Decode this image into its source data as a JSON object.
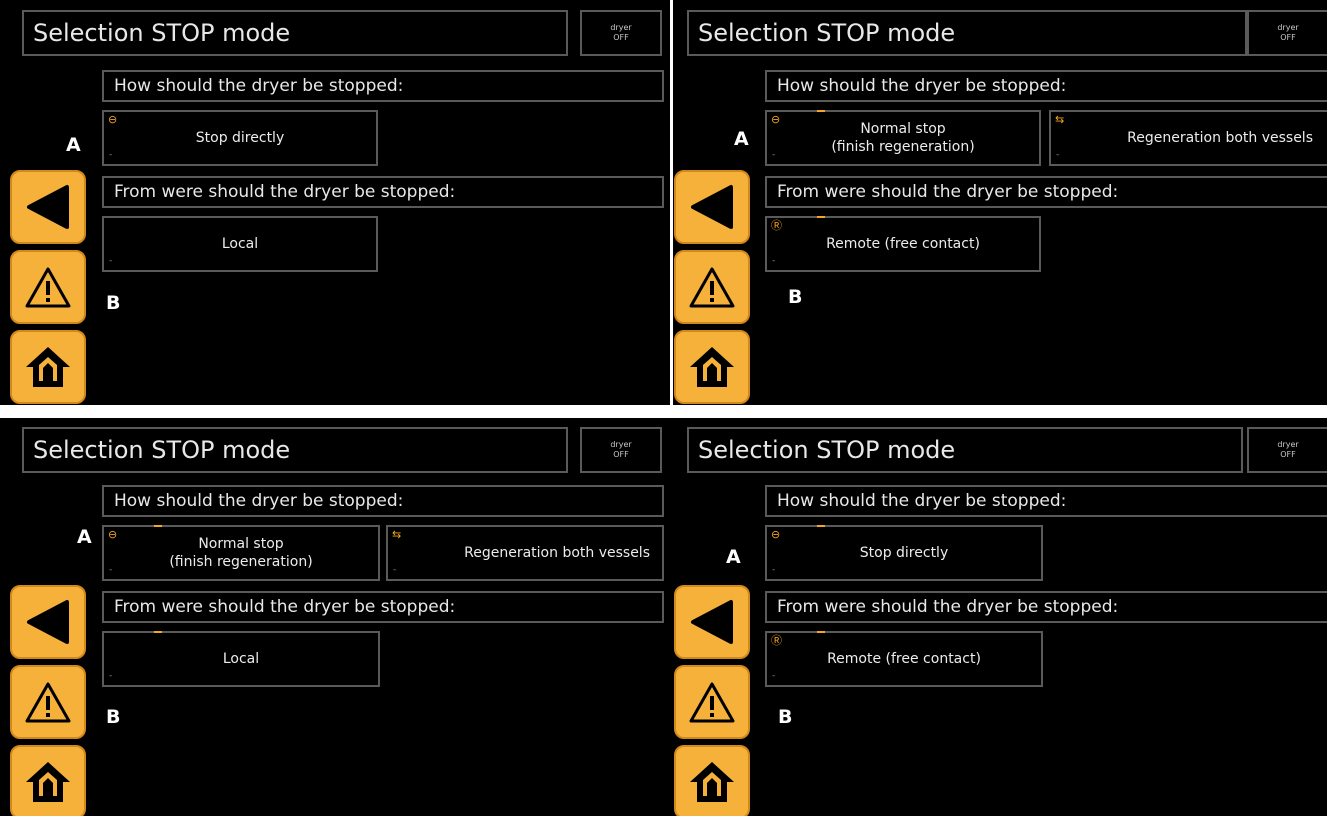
{
  "panels": [
    {
      "title": "Selection STOP mode",
      "status": {
        "line1": "dryer",
        "line2": "OFF"
      },
      "how_label": "How should the dryer be stopped:",
      "from_label": "From were should the dryer be stopped:",
      "how_options": [
        {
          "label": "Stop directly",
          "icon": "stop-circle-icon",
          "marker": "-"
        }
      ],
      "from_options": [
        {
          "label": "Local",
          "icon": "",
          "marker": "-"
        }
      ],
      "letters": {
        "a": "A",
        "b": "B"
      }
    },
    {
      "title": "Selection STOP mode",
      "status": {
        "line1": "dryer",
        "line2": "OFF"
      },
      "how_label": "How should the dryer be stopped:",
      "from_label": "From were should the dryer be stopped:",
      "how_options": [
        {
          "label": "Normal stop\n(finish regeneration)",
          "icon": "stop-circle-icon",
          "marker": "-"
        },
        {
          "label": "Regeneration both vessels",
          "icon": "regeneration-icon",
          "marker": "-"
        }
      ],
      "from_options": [
        {
          "label": "Remote (free contact)",
          "icon": "remote-icon",
          "marker": "-"
        }
      ],
      "letters": {
        "a": "A",
        "b": "B"
      }
    },
    {
      "title": "Selection STOP mode",
      "status": {
        "line1": "dryer",
        "line2": "OFF"
      },
      "how_label": "How should the dryer be stopped:",
      "from_label": "From were should the dryer be stopped:",
      "how_options": [
        {
          "label": "Normal stop\n(finish regeneration)",
          "icon": "stop-circle-icon",
          "marker": "-"
        },
        {
          "label": "Regeneration both vessels",
          "icon": "regeneration-icon",
          "marker": "-"
        }
      ],
      "from_options": [
        {
          "label": "Local",
          "icon": "",
          "marker": "-"
        }
      ],
      "letters": {
        "a": "A",
        "b": "B"
      }
    },
    {
      "title": "Selection STOP mode",
      "status": {
        "line1": "dryer",
        "line2": "OFF"
      },
      "how_label": "How should the dryer be stopped:",
      "from_label": "From were should the dryer be stopped:",
      "how_options": [
        {
          "label": "Stop directly",
          "icon": "stop-circle-icon",
          "marker": "-"
        }
      ],
      "from_options": [
        {
          "label": "Remote (free contact)",
          "icon": "remote-icon",
          "marker": "-"
        }
      ],
      "letters": {
        "a": "A",
        "b": "B"
      }
    }
  ],
  "side_buttons": [
    {
      "icon": "back-arrow-icon"
    },
    {
      "icon": "warning-icon"
    },
    {
      "icon": "home-icon"
    }
  ],
  "colors": {
    "accent": "#f5b13a",
    "background": "#000000",
    "border": "#5a5a5a"
  }
}
